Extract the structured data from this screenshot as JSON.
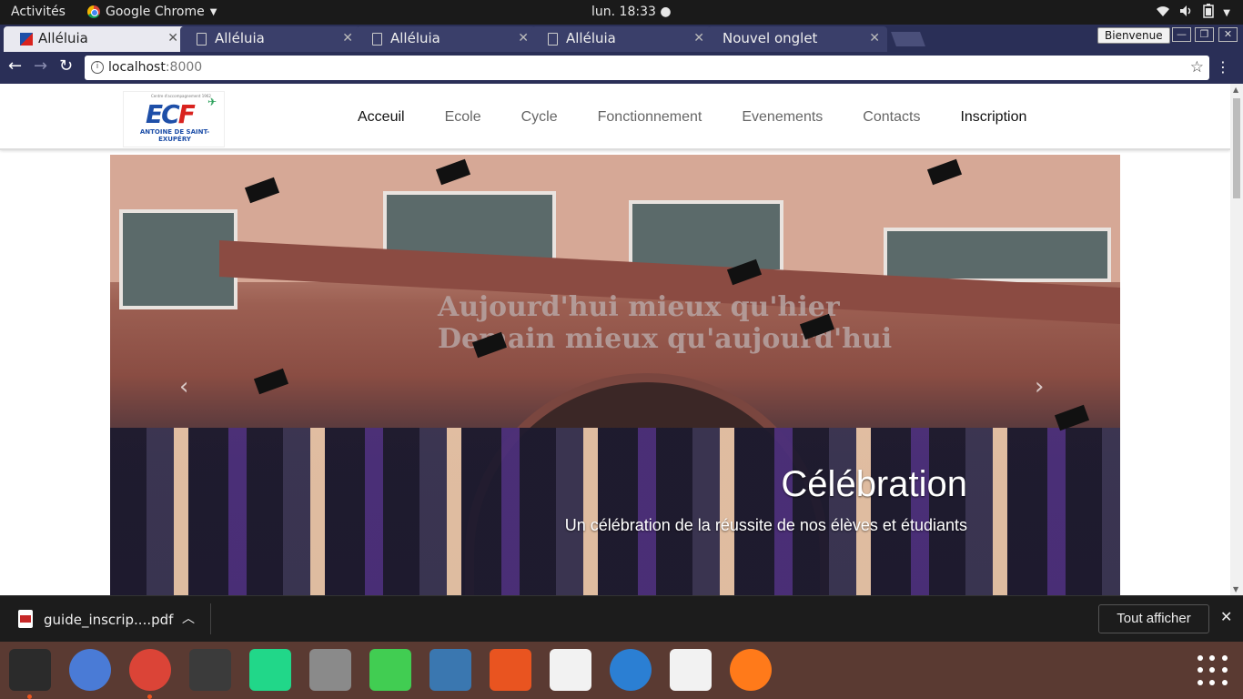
{
  "system_bar": {
    "activities": "Activités",
    "app_name": "Google Chrome",
    "clock": "lun. 18:33 ●"
  },
  "tabs": [
    {
      "label": "Alléluia",
      "active": true
    },
    {
      "label": "Alléluia",
      "active": false
    },
    {
      "label": "Alléluia",
      "active": false
    },
    {
      "label": "Alléluia",
      "active": false
    },
    {
      "label": "Nouvel onglet",
      "active": false
    }
  ],
  "profile_button": "Bienvenue",
  "address_bar": {
    "host": "localhost",
    "port": ":8000"
  },
  "site": {
    "logo": {
      "top_text": "Centre d'accompagnement 1962",
      "mark": "EC",
      "mark_accent": "F",
      "name": "ANTOINE DE SAINT-EXUPÉRY"
    },
    "nav": [
      {
        "label": "Acceuil",
        "strong": true
      },
      {
        "label": "Ecole",
        "strong": false
      },
      {
        "label": "Cycle",
        "strong": false
      },
      {
        "label": "Fonctionnement",
        "strong": false
      },
      {
        "label": "Evenements",
        "strong": false
      },
      {
        "label": "Contacts",
        "strong": false
      },
      {
        "label": "Inscription",
        "strong": true
      }
    ],
    "carousel": {
      "sign_line1": "Aujourd'hui mieux qu'hier",
      "sign_line2": "Demain mieux qu'aujourd'hui",
      "caption_title": "Célébration",
      "caption_text": "Un célébration de la réussite de nos élèves et étudiants"
    }
  },
  "downloads": {
    "file_name": "guide_inscrip....pdf",
    "show_all": "Tout afficher"
  },
  "dock": [
    {
      "name": "terminal-icon",
      "color": "#2b2b2b"
    },
    {
      "name": "chromium-icon",
      "color": "#4a7bd6"
    },
    {
      "name": "chrome-icon",
      "color": "#db4437"
    },
    {
      "name": "sublime-text-icon",
      "color": "#3b3b3b"
    },
    {
      "name": "pycharm-icon",
      "color": "#21d789"
    },
    {
      "name": "files-icon",
      "color": "#8a8a8a"
    },
    {
      "name": "qt-creator-icon",
      "color": "#41cd52"
    },
    {
      "name": "python-icon",
      "color": "#3a77b0"
    },
    {
      "name": "software-center-icon",
      "color": "#e95420"
    },
    {
      "name": "document-viewer-icon",
      "color": "#f2f2f2"
    },
    {
      "name": "help-icon",
      "color": "#2b7fd3"
    },
    {
      "name": "amazon-icon",
      "color": "#f2f2f2"
    },
    {
      "name": "firefox-icon",
      "color": "#ff7a1a"
    }
  ]
}
